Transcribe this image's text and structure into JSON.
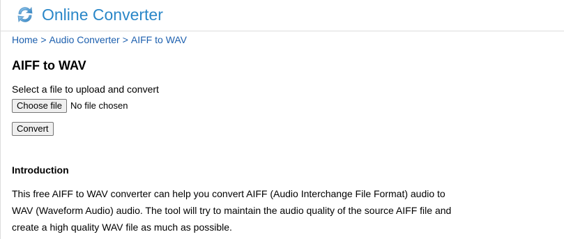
{
  "header": {
    "logo_icon": "refresh-arrows-icon",
    "brand_name": "Online Converter",
    "brand_color": "#2a87c8"
  },
  "breadcrumb": {
    "items": [
      "Home",
      "Audio Converter",
      "AIFF to WAV"
    ],
    "separator": ">",
    "link_color": "#1c5fae"
  },
  "main": {
    "title": "AIFF to WAV",
    "upload_label": "Select a file to upload and convert",
    "choose_file_button": "Choose file",
    "file_status": "No file chosen",
    "convert_button": "Convert"
  },
  "introduction": {
    "heading": "Introduction",
    "paragraph": "This free AIFF to WAV converter can help you convert AIFF (Audio Interchange File Format) audio to WAV (Waveform Audio) audio. The tool will try to maintain the audio quality of the source AIFF file and create a high quality WAV file as much as possible."
  }
}
